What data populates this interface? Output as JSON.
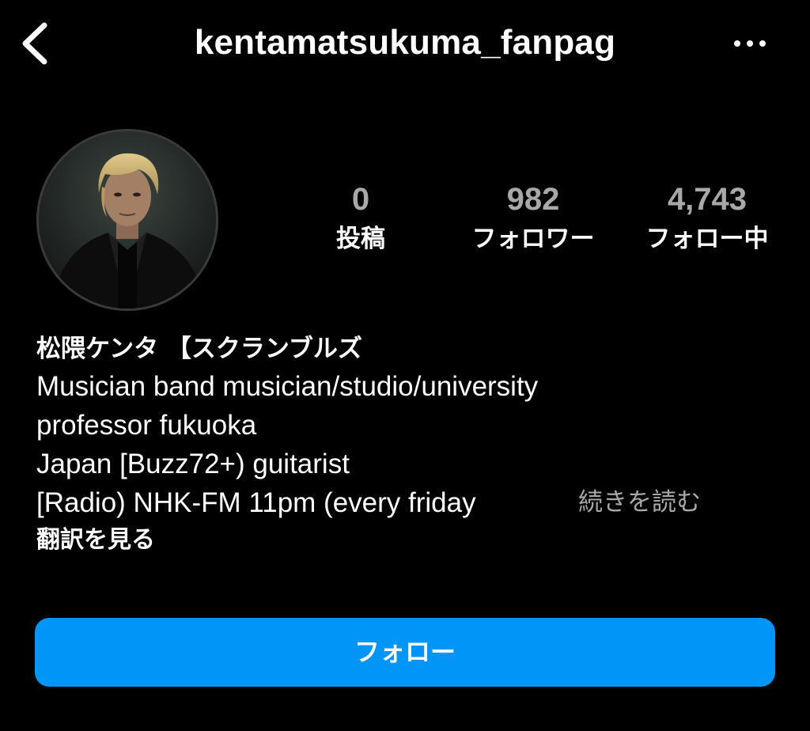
{
  "header": {
    "username": "kentamatsukuma_fanpag"
  },
  "stats": {
    "posts": {
      "value": "0",
      "label": "投稿"
    },
    "followers": {
      "value": "982",
      "label": "フォロワー"
    },
    "following": {
      "value": "4,743",
      "label": "フォロー中"
    }
  },
  "bio": {
    "name": "松隈ケンタ 【スクランブルズ",
    "lines": [
      "Musician band musician/studio/university",
      "professor fukuoka",
      "Japan [Buzz72+) guitarist",
      "[Radio) NHK-FM 11pm (every friday"
    ],
    "read_more": "続きを読む",
    "translate": "翻訳を見る"
  },
  "actions": {
    "follow_label": "フォロー"
  },
  "colors": {
    "background": "#000000",
    "text": "#ffffff",
    "muted": "#a8a8a8",
    "accent": "#0095f6"
  },
  "icons": {
    "back": "chevron-left-icon",
    "more": "more-horizontal-icon"
  }
}
